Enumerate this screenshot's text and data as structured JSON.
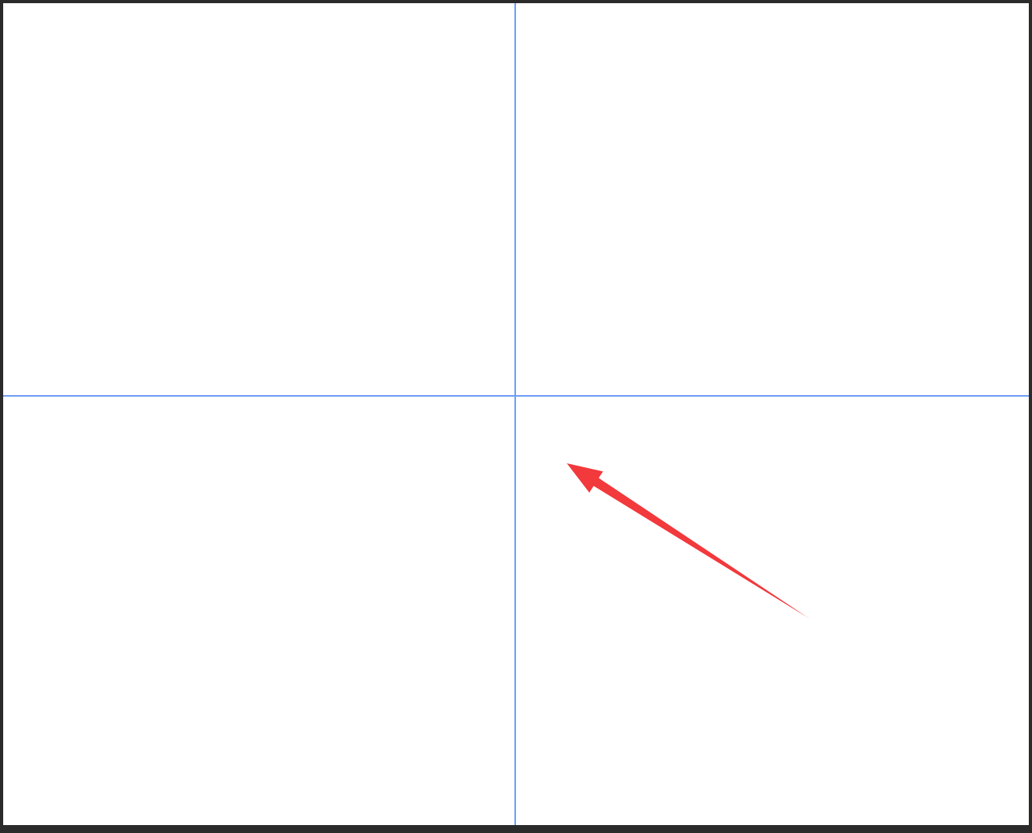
{
  "canvas": {
    "vertical_guide": true,
    "horizontal_guide": true,
    "annotations": [
      {
        "kind": "arrow"
      }
    ]
  }
}
